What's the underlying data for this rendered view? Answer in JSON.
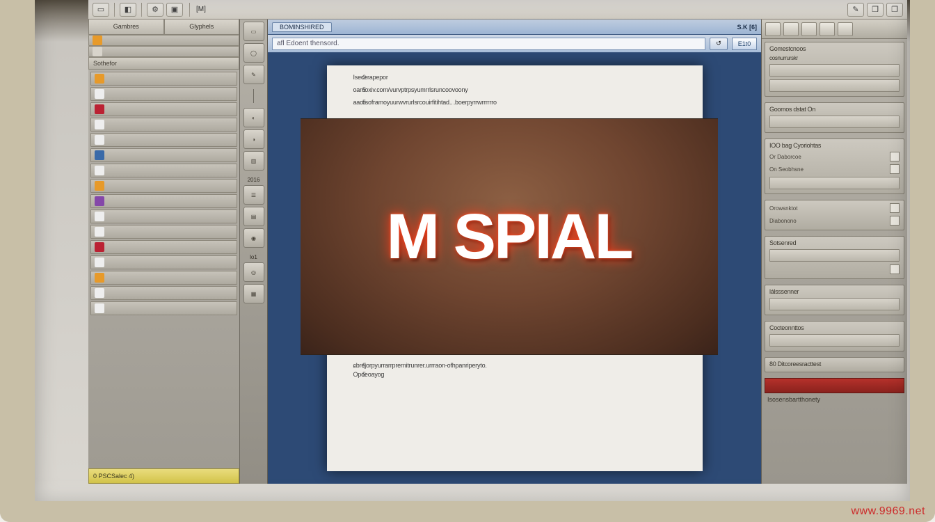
{
  "menubar": {
    "left_icons": [
      "doc",
      "view",
      "tools",
      "win"
    ],
    "center_label": "[M]",
    "right_icons": [
      "min",
      "max",
      "close"
    ]
  },
  "left_sidebar": {
    "tabs": [
      "Gambres",
      "Glyphels"
    ],
    "section1_header": "Sothefor",
    "items": [
      {
        "cls": "og",
        "label": ""
      },
      {
        "cls": "wh",
        "label": ""
      },
      {
        "cls": "red",
        "label": ""
      },
      {
        "cls": "wh",
        "label": ""
      },
      {
        "cls": "wh",
        "label": ""
      },
      {
        "cls": "bl",
        "label": ""
      },
      {
        "cls": "wh",
        "label": ""
      },
      {
        "cls": "og",
        "label": ""
      },
      {
        "cls": "pp",
        "label": ""
      },
      {
        "cls": "wh",
        "label": ""
      },
      {
        "cls": "wh",
        "label": ""
      },
      {
        "cls": "red",
        "label": ""
      },
      {
        "cls": "wh",
        "label": ""
      },
      {
        "cls": "og",
        "label": ""
      },
      {
        "cls": "wh",
        "label": ""
      },
      {
        "cls": "wh",
        "label": ""
      }
    ],
    "status_label": "0 PSCSalec  4)"
  },
  "toolstrip": {
    "buttons": [
      "01",
      "02",
      "03",
      "04",
      "05",
      "06",
      "07",
      "08",
      "09",
      "10",
      "11"
    ],
    "labels": {
      "mid": "2016",
      "low": "lo1"
    }
  },
  "center": {
    "tab_name": "BOMINSHIRED",
    "tab_counter": "S.K [6]",
    "url_text": "afl Edoent thensord.",
    "nav_icon": "↺",
    "go_label": "E1t0",
    "page": {
      "lines_top": [
        {
          "n": "0",
          "t": "Isecerapepor"
        },
        {
          "n": "5",
          "t": "oamoxiv.com/vurvptrpsyumrrlsruncoovoony"
        },
        {
          "n": "5",
          "t": "aaorsoframoyuurwvrurlsrcouirfitihtad..  .boerpyrrwrrrrrro"
        }
      ],
      "hero_text": "M SPIAL",
      "lines_bot": [
        {
          "n": "9",
          "t": "ɕbrejorpyurrarrprernitrunrer.urrraon-ofhpanriperyto."
        },
        {
          "n": "5",
          "t": "Opoeoayoɡ"
        }
      ]
    }
  },
  "right_panels": {
    "top_buttons": 5,
    "sections": [
      {
        "header": "Gomestcnoos",
        "sub": "cosnurrurskr",
        "fields": 2
      },
      {
        "header": "Goomos dstat On",
        "fields": 1
      },
      {
        "header": "IOO bag Cyoriohtas",
        "rows": [
          {
            "label": "Or Daborcoe",
            "chk": true
          },
          {
            "label": "On Seobhsne",
            "chk": true
          }
        ],
        "fields": 1
      },
      {
        "header": "",
        "rows": [
          {
            "label": "Orowsnktot",
            "chk": false
          },
          {
            "label": "Diabonono",
            "chk": true
          }
        ]
      },
      {
        "header": "Sotsenred",
        "fields": 1,
        "chk": true
      },
      {
        "header": "lálsssenner",
        "fields": 1
      },
      {
        "header": "Cocteonnttos",
        "fields": 1
      },
      {
        "header": "80   Ditcoreesracttest",
        "small": true
      },
      {
        "header": "Isosensbartthonety",
        "red": true
      }
    ]
  },
  "watermark": "www.9969.net"
}
